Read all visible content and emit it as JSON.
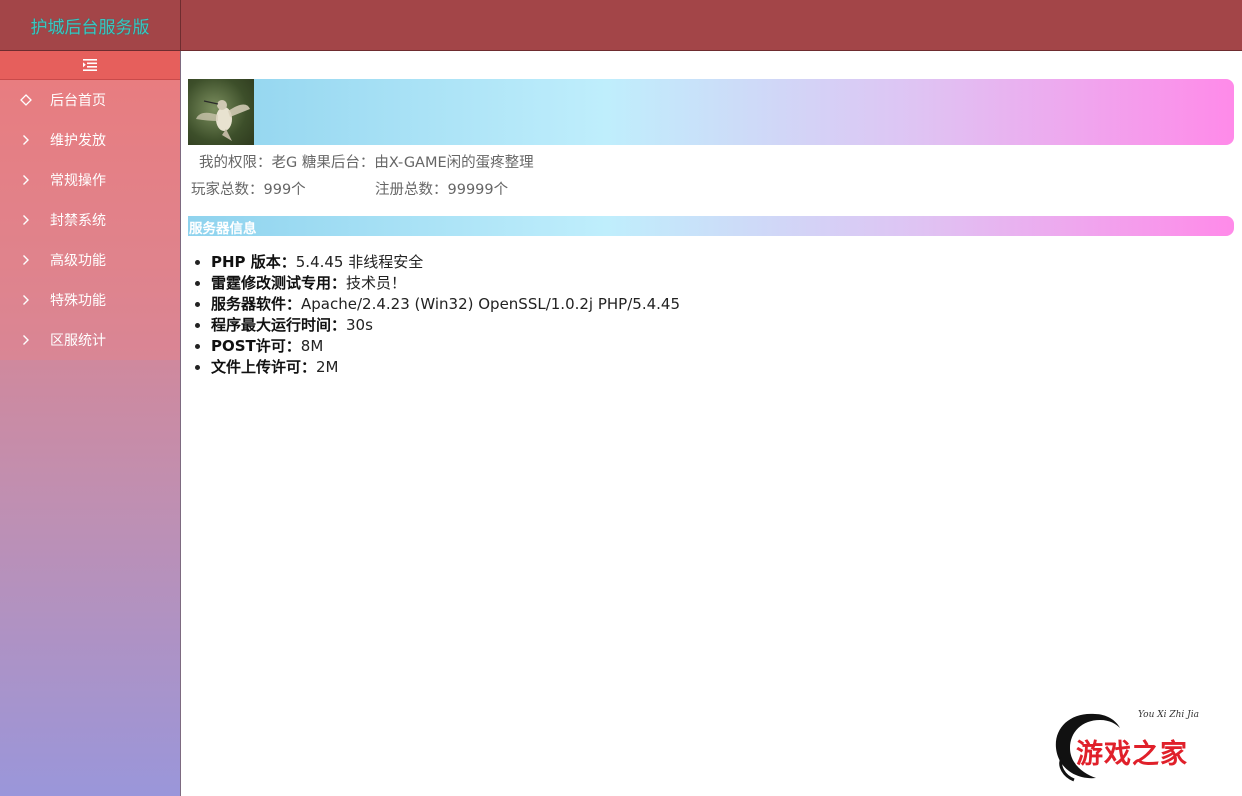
{
  "app": {
    "brand_title": "护城后台服务版"
  },
  "sidebar": {
    "items": [
      {
        "label": "后台首页",
        "icon": "diamond-icon"
      },
      {
        "label": "维护发放",
        "icon": "chevron-right-icon"
      },
      {
        "label": "常规操作",
        "icon": "chevron-right-icon"
      },
      {
        "label": "封禁系统",
        "icon": "chevron-right-icon"
      },
      {
        "label": "高级功能",
        "icon": "chevron-right-icon"
      },
      {
        "label": "特殊功能",
        "icon": "chevron-right-icon"
      },
      {
        "label": "区服统计",
        "icon": "chevron-right-icon"
      }
    ]
  },
  "profile": {
    "permission_line": "我的权限：老G   糖果后台：由X-GAME闲的蛋疼整理",
    "players_total": "玩家总数：999个",
    "registered_total": "注册总数：99999个"
  },
  "server_info": {
    "title": "服务器信息",
    "items": [
      {
        "key": "PHP 版本：",
        "value": "5.4.45 非线程安全"
      },
      {
        "key": "雷霆修改测试专用：",
        "value": "技术员！"
      },
      {
        "key": "服务器软件：",
        "value": "Apache/2.4.23 (Win32) OpenSSL/1.0.2j PHP/5.4.45"
      },
      {
        "key": "程序最大运行时间：",
        "value": "30s"
      },
      {
        "key": "POST许可：",
        "value": "8M"
      },
      {
        "key": "文件上传许可：",
        "value": "2M"
      }
    ]
  },
  "watermark": {
    "script": "You Xi Zhi Jia",
    "text": "游戏之家"
  },
  "colors": {
    "topbar": "#a34548",
    "accent_red": "#e0202a",
    "brand_text": "#3cc6c0"
  }
}
